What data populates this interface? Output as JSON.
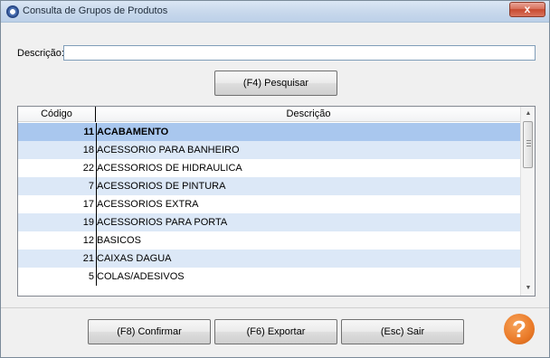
{
  "window": {
    "title": "Consulta de Grupos de Produtos",
    "close_glyph": "x"
  },
  "search": {
    "label": "Descrição:",
    "value": "",
    "button_label": "(F4) Pesquisar"
  },
  "grid": {
    "headers": {
      "code": "Código",
      "description": "Descrição"
    },
    "rows": [
      {
        "code": "11",
        "description": "ACABAMENTO"
      },
      {
        "code": "18",
        "description": "ACESSORIO PARA BANHEIRO"
      },
      {
        "code": "22",
        "description": "ACESSORIOS DE HIDRAULICA"
      },
      {
        "code": "7",
        "description": "ACESSORIOS DE PINTURA"
      },
      {
        "code": "17",
        "description": "ACESSORIOS EXTRA"
      },
      {
        "code": "19",
        "description": "ACESSORIOS PARA PORTA"
      },
      {
        "code": "12",
        "description": "BASICOS"
      },
      {
        "code": "21",
        "description": "CAIXAS DAGUA"
      },
      {
        "code": "5",
        "description": "COLAS/ADESIVOS"
      }
    ],
    "selected_index": 0
  },
  "footer": {
    "confirm_label": "(F8) Confirmar",
    "export_label": "(F6) Exportar",
    "exit_label": "(Esc) Sair",
    "help_glyph": "?"
  },
  "icons": {
    "app": "app-icon",
    "close": "close-icon",
    "help": "help-icon",
    "scroll_up": "scroll-up-icon",
    "scroll_down": "scroll-down-icon"
  },
  "colors": {
    "selected_row": "#a9c7ee",
    "alt_row": "#dce8f7",
    "help_orange": "#ea7a28",
    "close_red": "#c74a30"
  }
}
